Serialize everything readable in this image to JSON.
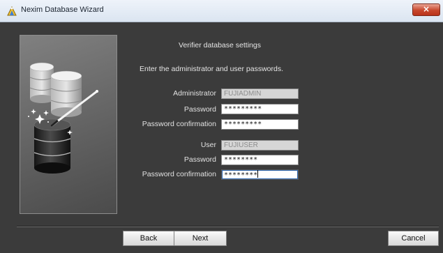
{
  "window": {
    "title": "Nexim Database Wizard",
    "close_symbol": "×",
    "icon": "wizard-app-icon"
  },
  "illustration": {
    "icon": "database-wand-illustration"
  },
  "main": {
    "heading": "Verifier database settings",
    "instruction": "Enter the administrator and user passwords.",
    "administrator": {
      "label": "Administrator",
      "value": "FUJIADMIN",
      "password_label": "Password",
      "password_value": "*********",
      "confirm_label": "Password confirmation",
      "confirm_value": "*********"
    },
    "user": {
      "label": "User",
      "value": "FUJIUSER",
      "password_label": "Password",
      "password_value": "********",
      "confirm_label": "Password confirmation",
      "confirm_value": "********"
    }
  },
  "buttons": {
    "back": "Back",
    "next": "Next",
    "cancel": "Cancel"
  },
  "colors": {
    "background": "#3b3b3b",
    "titlebar": "#dbe5f1",
    "close_button": "#c8472c",
    "text": "#e4e4e4"
  }
}
